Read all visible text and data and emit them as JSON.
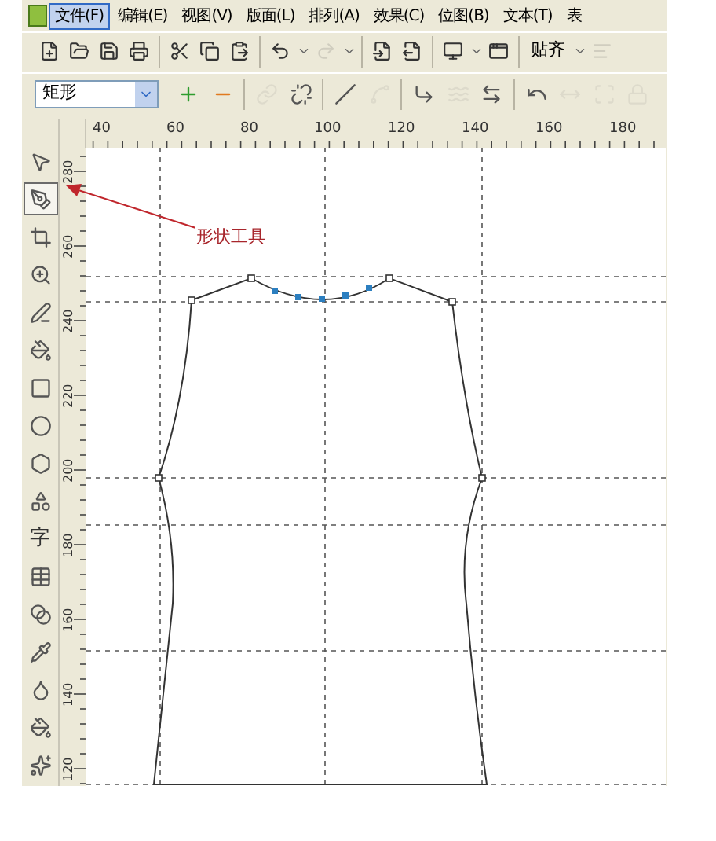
{
  "menu_bar": {
    "items": [
      {
        "label": "文件(F)",
        "selected": true
      },
      {
        "label": "编辑(E)",
        "selected": false
      },
      {
        "label": "视图(V)",
        "selected": false
      },
      {
        "label": "版面(L)",
        "selected": false
      },
      {
        "label": "排列(A)",
        "selected": false
      },
      {
        "label": "效果(C)",
        "selected": false
      },
      {
        "label": "位图(B)",
        "selected": false
      },
      {
        "label": "文本(T)",
        "selected": false
      },
      {
        "label": "表",
        "selected": false
      }
    ]
  },
  "standard_toolbar": {
    "items": [
      {
        "kind": "new",
        "disabled": false
      },
      {
        "kind": "open",
        "disabled": false
      },
      {
        "kind": "save",
        "disabled": false
      },
      {
        "kind": "print",
        "disabled": false
      },
      {
        "kind": "separator"
      },
      {
        "kind": "cut",
        "disabled": false
      },
      {
        "kind": "copy",
        "disabled": false
      },
      {
        "kind": "paste",
        "disabled": false
      },
      {
        "kind": "separator"
      },
      {
        "kind": "undo",
        "disabled": false
      },
      {
        "kind": "caret"
      },
      {
        "kind": "redo",
        "disabled": true
      },
      {
        "kind": "caret"
      },
      {
        "kind": "separator"
      },
      {
        "kind": "import",
        "disabled": false
      },
      {
        "kind": "export",
        "disabled": false
      },
      {
        "kind": "separator"
      },
      {
        "kind": "monitor",
        "disabled": false
      },
      {
        "kind": "caret"
      },
      {
        "kind": "window",
        "disabled": false
      },
      {
        "kind": "separator"
      },
      {
        "kind": "label",
        "label": "贴齐"
      },
      {
        "kind": "caret"
      },
      {
        "kind": "align",
        "disabled": true
      }
    ]
  },
  "property_bar": {
    "dropdown": {
      "value": "矩形"
    },
    "items": [
      {
        "kind": "add-node",
        "disabled": false
      },
      {
        "kind": "delete-node",
        "disabled": false
      },
      {
        "kind": "separator"
      },
      {
        "kind": "join",
        "disabled": true
      },
      {
        "kind": "break",
        "disabled": false
      },
      {
        "kind": "separator"
      },
      {
        "kind": "to-line",
        "disabled": false
      },
      {
        "kind": "to-curve",
        "disabled": true
      },
      {
        "kind": "separator"
      },
      {
        "kind": "cusp",
        "disabled": false
      },
      {
        "kind": "smooth",
        "disabled": true
      },
      {
        "kind": "symmetric",
        "disabled": false
      },
      {
        "kind": "separator"
      },
      {
        "kind": "reverse",
        "disabled": false
      },
      {
        "kind": "extend",
        "disabled": true
      },
      {
        "kind": "extract",
        "disabled": true
      },
      {
        "kind": "close",
        "disabled": true
      }
    ]
  },
  "toolbox": {
    "tools": [
      {
        "kind": "pick",
        "selected": false
      },
      {
        "kind": "shape",
        "selected": true
      },
      {
        "kind": "crop",
        "selected": false
      },
      {
        "kind": "zoom",
        "selected": false
      },
      {
        "kind": "freehand",
        "selected": false
      },
      {
        "kind": "smart-fill",
        "selected": false
      },
      {
        "kind": "rectangle",
        "selected": false
      },
      {
        "kind": "ellipse",
        "selected": false
      },
      {
        "kind": "polygon",
        "selected": false
      },
      {
        "kind": "basic-shapes",
        "selected": false
      },
      {
        "kind": "text",
        "label": "字",
        "selected": false
      },
      {
        "kind": "table",
        "selected": false
      },
      {
        "kind": "blend",
        "selected": false
      },
      {
        "kind": "eyedropper",
        "selected": false
      },
      {
        "kind": "outline",
        "selected": false
      },
      {
        "kind": "fill",
        "selected": false
      },
      {
        "kind": "interactive-fill",
        "selected": false
      }
    ]
  },
  "horizontal_ruler": {
    "labels": [
      "40",
      "60",
      "80",
      "100",
      "120",
      "140",
      "160",
      "180"
    ]
  },
  "vertical_ruler": {
    "labels": [
      "280",
      "260",
      "240",
      "220",
      "200",
      "180",
      "160",
      "140",
      "120"
    ]
  },
  "annotation": {
    "label": "形状工具"
  }
}
